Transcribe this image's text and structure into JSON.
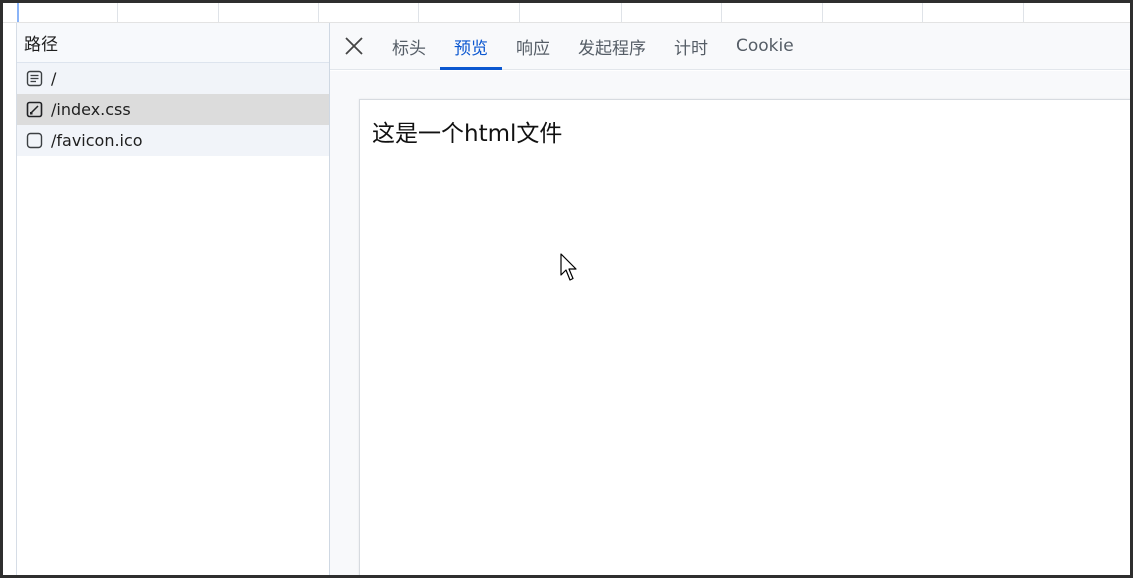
{
  "left_panel": {
    "header": "路径",
    "requests": [
      {
        "path": "/",
        "icon": "document-icon"
      },
      {
        "path": "/index.css",
        "icon": "stylesheet-icon"
      },
      {
        "path": "/favicon.ico",
        "icon": "image-icon"
      }
    ]
  },
  "details": {
    "tabs": [
      {
        "label": "标头"
      },
      {
        "label": "预览"
      },
      {
        "label": "响应"
      },
      {
        "label": "发起程序"
      },
      {
        "label": "计时"
      },
      {
        "label": "Cookie"
      }
    ],
    "active_tab": "预览"
  },
  "preview": {
    "content": "这是一个html文件"
  },
  "colors": {
    "accent": "#0b57d0",
    "selected_row": "#dcdcdc",
    "odd_row": "#f1f4f9"
  }
}
